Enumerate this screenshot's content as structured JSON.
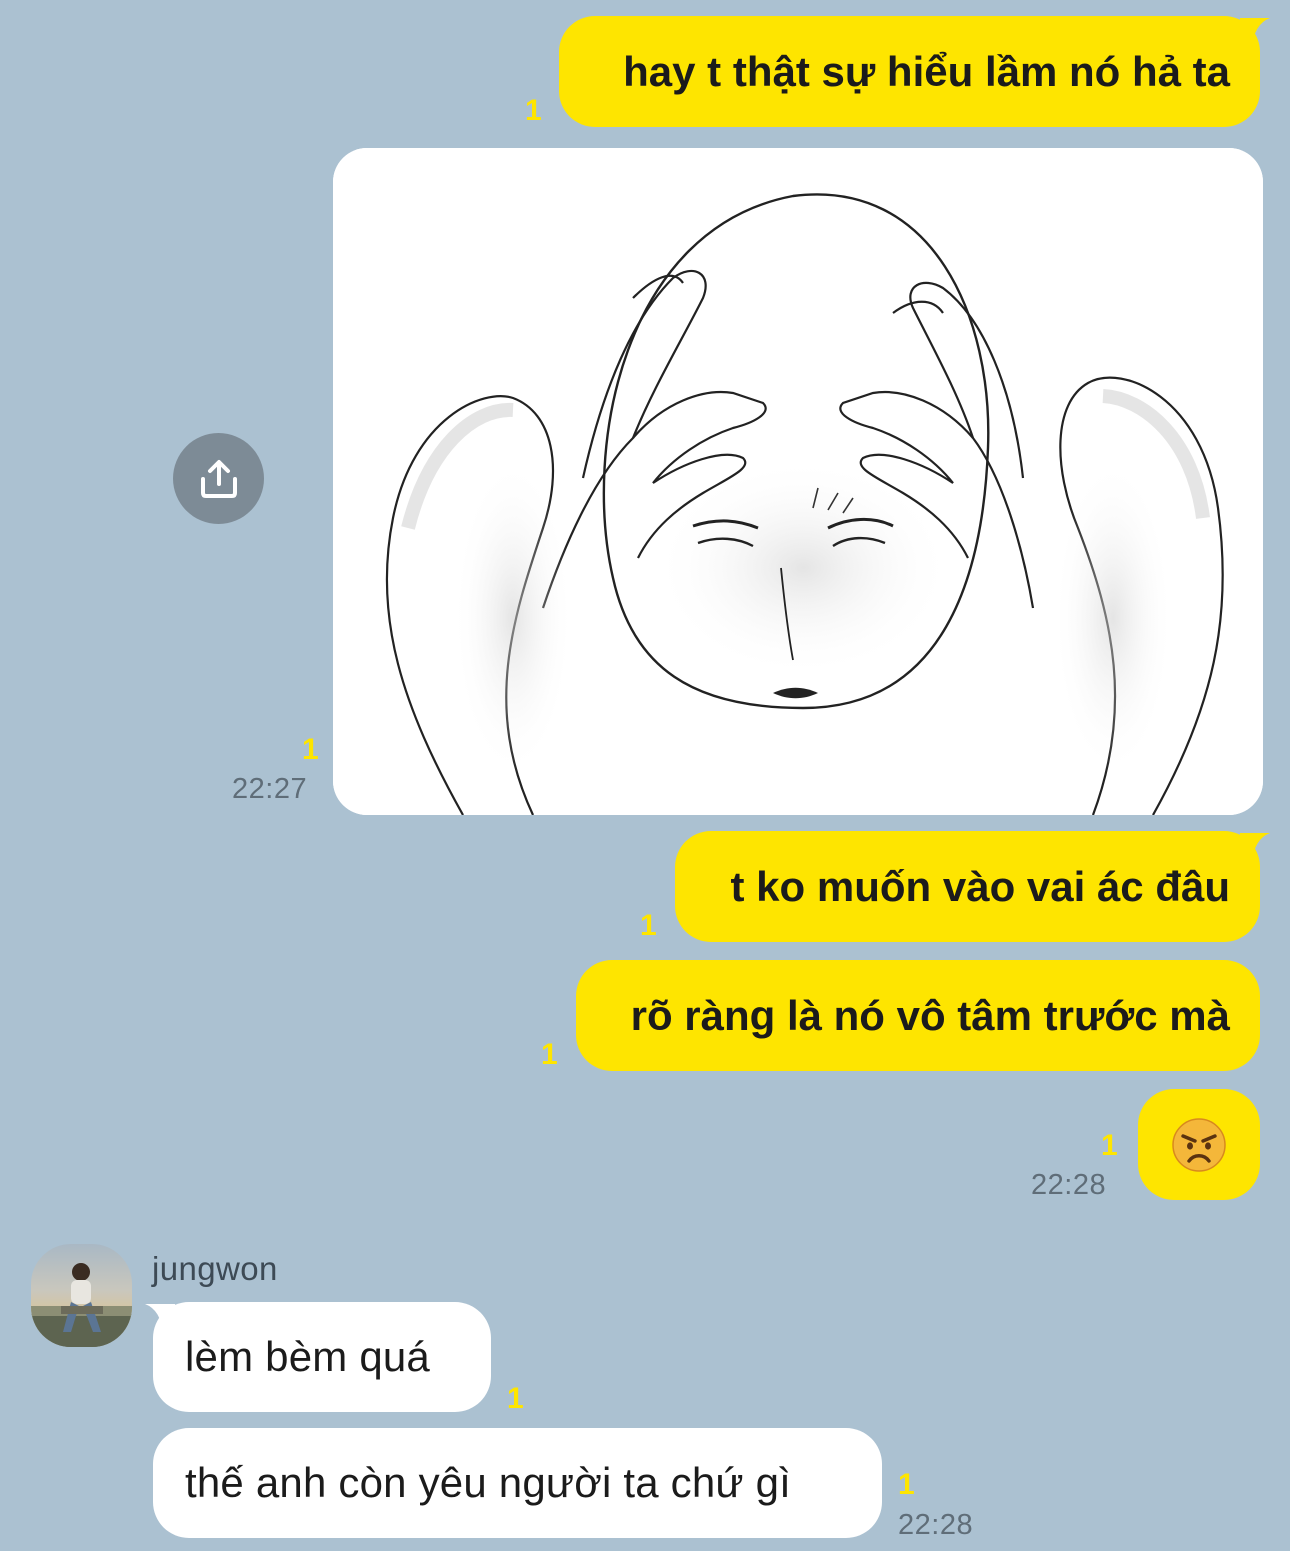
{
  "chat": {
    "outgoing": [
      {
        "text": "hay t thật sự hiểu lầm nó hả ta",
        "unread": "1"
      },
      {
        "type": "image",
        "alt": "",
        "unread": "1",
        "time": "22:27"
      },
      {
        "text": "t ko muốn vào vai ác đâu",
        "unread": "1"
      },
      {
        "text": "rõ ràng là nó vô tâm trước mà",
        "unread": "1"
      },
      {
        "emoji": "😠",
        "emoji_icon": "angry-face-emoji",
        "unread": "1",
        "time": "22:28"
      }
    ],
    "incoming": {
      "sender": "jungwon",
      "messages": [
        {
          "text": "lèm bèm quá",
          "unread": "1"
        },
        {
          "text": "thế anh còn yêu người ta chứ gì",
          "unread": "1",
          "time": "22:28"
        }
      ]
    }
  },
  "icons": {
    "share": "share-upload-icon"
  },
  "colors": {
    "background": "#abc1d1",
    "outgoing_bubble": "#fee500",
    "incoming_bubble": "#ffffff",
    "unread_count": "#fee500",
    "share_button": "#7d8b96"
  }
}
